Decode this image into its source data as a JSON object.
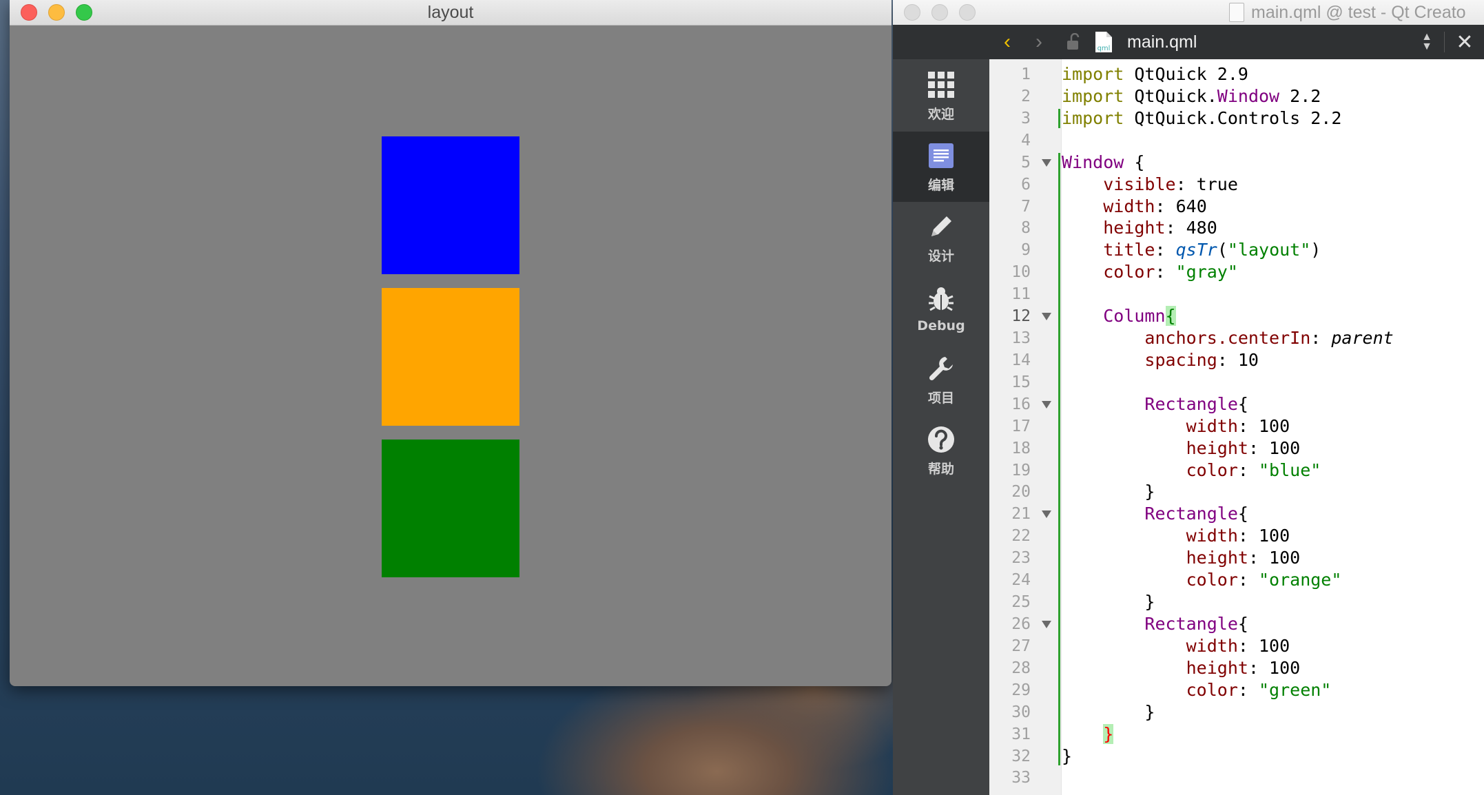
{
  "app_window": {
    "title": "layout",
    "background": "#808080",
    "rectangles": [
      {
        "name": "blue",
        "color": "#0000ff"
      },
      {
        "name": "orange",
        "color": "#ffa500"
      },
      {
        "name": "green",
        "color": "#008000"
      }
    ]
  },
  "creator": {
    "title": "main.qml @ test - Qt Creato",
    "file_name": "main.qml",
    "file_badge": "qml",
    "modes": [
      {
        "label": "欢迎",
        "icon": "grid-icon"
      },
      {
        "label": "编辑",
        "icon": "document-edit-icon",
        "active": true
      },
      {
        "label": "设计",
        "icon": "pencil-icon"
      },
      {
        "label": "Debug",
        "icon": "bug-icon"
      },
      {
        "label": "项目",
        "icon": "wrench-icon"
      },
      {
        "label": "帮助",
        "icon": "help-icon"
      }
    ],
    "current_line": 12,
    "code_lines": [
      {
        "n": "1",
        "t": "import QtQuick 2.9"
      },
      {
        "n": "2",
        "t": "import QtQuick.Window 2.2"
      },
      {
        "n": "3",
        "t": "import QtQuick.Controls 2.2"
      },
      {
        "n": "4",
        "t": ""
      },
      {
        "n": "5",
        "t": "Window {"
      },
      {
        "n": "6",
        "t": "    visible: true"
      },
      {
        "n": "7",
        "t": "    width: 640"
      },
      {
        "n": "8",
        "t": "    height: 480"
      },
      {
        "n": "9",
        "t": "    title: qsTr(\"layout\")"
      },
      {
        "n": "10",
        "t": "    color: \"gray\""
      },
      {
        "n": "11",
        "t": ""
      },
      {
        "n": "12",
        "t": "    Column{"
      },
      {
        "n": "13",
        "t": "        anchors.centerIn: parent"
      },
      {
        "n": "14",
        "t": "        spacing: 10"
      },
      {
        "n": "15",
        "t": ""
      },
      {
        "n": "16",
        "t": "        Rectangle{"
      },
      {
        "n": "17",
        "t": "            width: 100"
      },
      {
        "n": "18",
        "t": "            height: 100"
      },
      {
        "n": "19",
        "t": "            color: \"blue\""
      },
      {
        "n": "20",
        "t": "        }"
      },
      {
        "n": "21",
        "t": "        Rectangle{"
      },
      {
        "n": "22",
        "t": "            width: 100"
      },
      {
        "n": "23",
        "t": "            height: 100"
      },
      {
        "n": "24",
        "t": "            color: \"orange\""
      },
      {
        "n": "25",
        "t": "        }"
      },
      {
        "n": "26",
        "t": "        Rectangle{"
      },
      {
        "n": "27",
        "t": "            width: 100"
      },
      {
        "n": "28",
        "t": "            height: 100"
      },
      {
        "n": "29",
        "t": "            color: \"green\""
      },
      {
        "n": "30",
        "t": "        }"
      },
      {
        "n": "31",
        "t": "    }"
      },
      {
        "n": "32",
        "t": "}"
      },
      {
        "n": "33",
        "t": ""
      }
    ],
    "fold_lines": [
      5,
      12,
      16,
      21,
      26
    ],
    "syntax_colors": {
      "import": "#808000",
      "type": "#800080",
      "property": "#800000",
      "string": "#008000",
      "function": "#0057ae"
    }
  }
}
